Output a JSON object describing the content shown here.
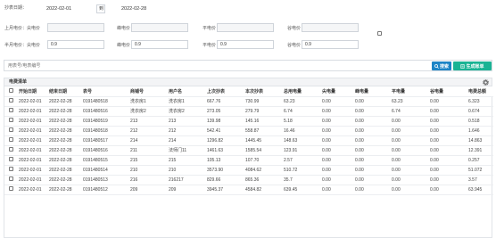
{
  "filters": {
    "date_label": "抄表日期：",
    "date_from": "2022-02-01",
    "date_sep": "到",
    "date_to": "2022-02-28",
    "last_month": {
      "sharp_label": "上月电价：尖电价",
      "peak_label": "峰电价",
      "flat_label": "平电价",
      "valley_label": "谷电价",
      "sharp": "",
      "peak": "",
      "flat": "",
      "valley": ""
    },
    "half_month": {
      "sharp_label": "半月电价：尖电价",
      "peak_label": "峰电价",
      "flat_label": "平电价",
      "valley_label": "谷电价",
      "sharp": "0.9",
      "peak": "0.9",
      "flat": "0.9",
      "valley": "0.9"
    }
  },
  "search": {
    "placeholder": "用表号/电表编号",
    "search_label": "搜索",
    "generate_label": "生成账单"
  },
  "panel": {
    "title": "电费清单"
  },
  "colors": {
    "search_btn": "#1c84c6",
    "generate_btn": "#1ab394"
  },
  "table": {
    "headers": [
      "开始日期",
      "结束日期",
      "表号",
      "商铺号",
      "用户名",
      "上次抄表",
      "本次抄表",
      "总用电量",
      "尖电量",
      "峰电量",
      "平电量",
      "谷电量",
      "电费总额"
    ],
    "rows": [
      [
        "2022-02-01",
        "2022-02-28",
        "0191480518",
        "洗衣房1",
        "洗衣房1",
        "667.76",
        "730.99",
        "63.23",
        "0.00",
        "0.00",
        "63.23",
        "0.00",
        "6.323"
      ],
      [
        "2022-02-01",
        "2022-02-28",
        "0191480516",
        "洗衣房2",
        "洗衣房2",
        "273.05",
        "279.79",
        "6.74",
        "0.00",
        "0.00",
        "6.74",
        "0.00",
        "0.674"
      ],
      [
        "2022-02-01",
        "2022-02-28",
        "0191480519",
        "213",
        "213",
        "139.98",
        "145.16",
        "5.18",
        "0.00",
        "0.00",
        "0.00",
        "0.00",
        "0.518"
      ],
      [
        "2022-02-01",
        "2022-02-28",
        "0191480518",
        "212",
        "212",
        "542.41",
        "558.87",
        "16.46",
        "0.00",
        "0.00",
        "0.00",
        "0.00",
        "1.646"
      ],
      [
        "2022-02-01",
        "2022-02-28",
        "0191480517",
        "214",
        "214",
        "1296.82",
        "1445.45",
        "148.63",
        "0.00",
        "0.00",
        "0.00",
        "0.00",
        "14.863"
      ],
      [
        "2022-02-01",
        "2022-02-28",
        "0191480516",
        "211",
        "法师门11",
        "1461.63",
        "1585.54",
        "123.91",
        "0.00",
        "0.00",
        "0.00",
        "0.00",
        "12.391"
      ],
      [
        "2022-02-01",
        "2022-02-28",
        "0191480515",
        "215",
        "215",
        "105.13",
        "107.70",
        "2.57",
        "0.00",
        "0.00",
        "0.00",
        "0.00",
        "0.257"
      ],
      [
        "2022-02-01",
        "2022-02-28",
        "0191480514",
        "210",
        "210",
        "3573.90",
        "4084.62",
        "510.72",
        "0.00",
        "0.00",
        "0.00",
        "0.00",
        "51.072"
      ],
      [
        "2022-02-01",
        "2022-02-28",
        "0191480513",
        "216",
        "216217",
        "829.66",
        "865.36",
        "35.7",
        "0.00",
        "0.00",
        "0.00",
        "0.00",
        "3.57"
      ],
      [
        "2022-02-01",
        "2022-02-28",
        "0191480512",
        "209",
        "209",
        "3945.37",
        "4584.82",
        "639.45",
        "0.00",
        "0.00",
        "0.00",
        "0.00",
        "63.945"
      ]
    ]
  }
}
